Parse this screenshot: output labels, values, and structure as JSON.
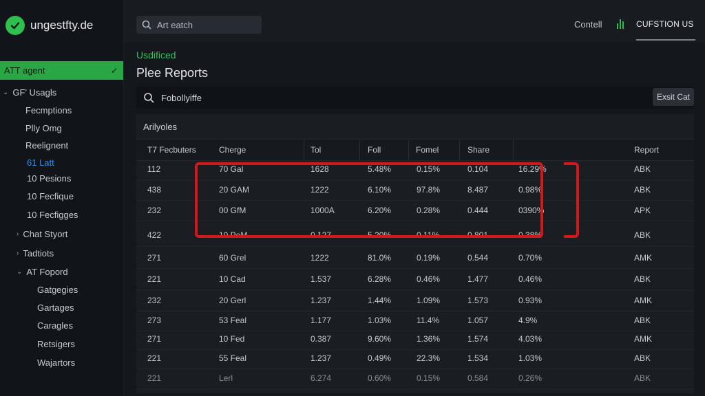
{
  "app": {
    "logo_text": "ungestfty.de"
  },
  "sidebar": {
    "active_item": "ATT agent",
    "items": [
      {
        "label": "GF' Usagls",
        "chev": "⌄"
      },
      {
        "label": "Fecmptions"
      },
      {
        "label": "Plly Omg"
      },
      {
        "label": "Reelignent"
      },
      {
        "label": "61 Latt"
      },
      {
        "label": "10 Pesions"
      },
      {
        "label": "10 Fecfique"
      },
      {
        "label": "10 Fecfigges"
      },
      {
        "label": "Chat Styort",
        "chev": "›"
      },
      {
        "label": "Tadtiots",
        "chev": "›"
      },
      {
        "label": "AT Fopord",
        "chev": "⌄"
      },
      {
        "label": "Gatgegies"
      },
      {
        "label": "Gartages"
      },
      {
        "label": "Caragles"
      },
      {
        "label": "Retsigers"
      },
      {
        "label": "Wajartors"
      }
    ]
  },
  "topbar": {
    "search_placeholder": "Art eatch",
    "link": "Contell",
    "cta": "CUFSTION US"
  },
  "breadcrumb": "Usdificed",
  "page_title": "Plee Reports",
  "filter": {
    "value": "Fobollyiffe",
    "button": "Exsit Cat"
  },
  "table": {
    "section_label": "Arilyoles",
    "columns": [
      "T7 Fecbuters",
      "Cherge",
      "Tol",
      "Foll",
      "Fomel",
      "Share",
      "Report"
    ],
    "rows": [
      [
        "112",
        "70 Gal",
        "1628",
        "5.48%",
        "0.15%",
        "0.104",
        "16.29%",
        "ABK"
      ],
      [
        "438",
        "20 GAM",
        "1222",
        "6.10%",
        "97.8%",
        "8.487",
        "0.98%",
        "ABK"
      ],
      [
        "232",
        "00 GfM",
        "1000A",
        "6.20%",
        "0.28%",
        "0.444",
        "0390%",
        "APK"
      ],
      [
        "422",
        "10 PeM",
        "0.127",
        "5.20%",
        "0.11%",
        "0.801",
        "0.38%",
        "ABK"
      ],
      [
        "271",
        "60 Grel",
        "1222",
        "81.0%",
        "0.19%",
        "0.544",
        "0.70%",
        "AMK"
      ],
      [
        "221",
        "10 Cad",
        "1.537",
        "6.28%",
        "0.46%",
        "1.477",
        "0.46%",
        "ABK"
      ],
      [
        "232",
        "20 Gerl",
        "1.237",
        "1.44%",
        "1.09%",
        "1.573",
        "0.93%",
        "AMK"
      ],
      [
        "273",
        "53 Feal",
        "1.177",
        "1.03%",
        "11.4%",
        "1.057",
        "4.9%",
        "ABK"
      ],
      [
        "271",
        "10 Fed",
        "0.387",
        "9.60%",
        "1.36%",
        "1.574",
        "4.03%",
        "AMK"
      ],
      [
        "221",
        "55 Feal",
        "1.237",
        "0.49%",
        "22.3%",
        "1.534",
        "1.03%",
        "ABK"
      ],
      [
        "221",
        "Lerl",
        "6.274",
        "0.60%",
        "0.15%",
        "0.584",
        "0.26%",
        "ABK"
      ]
    ]
  },
  "colors": {
    "accent_green": "#2aa745",
    "highlight_red": "#d21818",
    "link_blue": "#3a8fe8"
  }
}
